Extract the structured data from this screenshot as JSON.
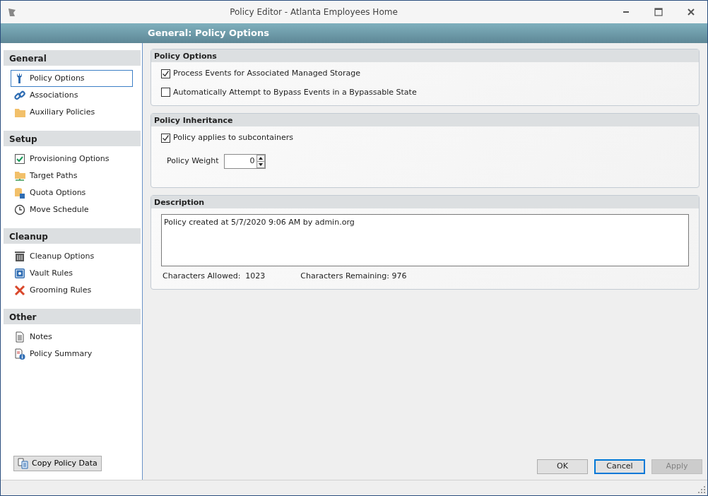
{
  "window": {
    "title": "Policy Editor - Atlanta Employees Home"
  },
  "header": {
    "title": "General: Policy Options"
  },
  "sidebar": {
    "sections": [
      {
        "title": "General",
        "items": [
          {
            "label": "Policy Options",
            "selected": true
          },
          {
            "label": "Associations",
            "selected": false
          },
          {
            "label": "Auxiliary Policies",
            "selected": false
          }
        ]
      },
      {
        "title": "Setup",
        "items": [
          {
            "label": "Provisioning Options",
            "selected": false
          },
          {
            "label": "Target Paths",
            "selected": false
          },
          {
            "label": "Quota Options",
            "selected": false
          },
          {
            "label": "Move Schedule",
            "selected": false
          }
        ]
      },
      {
        "title": "Cleanup",
        "items": [
          {
            "label": "Cleanup Options",
            "selected": false
          },
          {
            "label": "Vault Rules",
            "selected": false
          },
          {
            "label": "Grooming Rules",
            "selected": false
          }
        ]
      },
      {
        "title": "Other",
        "items": [
          {
            "label": "Notes",
            "selected": false
          },
          {
            "label": "Policy Summary",
            "selected": false
          }
        ]
      }
    ],
    "copy_button": "Copy Policy Data"
  },
  "panels": [
    {
      "title": "Policy Options",
      "fields": [
        {
          "kind": "checkbox",
          "label": "Process Events for Associated Managed Storage",
          "checked": true
        },
        {
          "kind": "checkbox",
          "label": "Automatically Attempt to Bypass Events in a Bypassable State",
          "checked": false
        }
      ]
    },
    {
      "title": "Policy Inheritance",
      "fields": [
        {
          "kind": "checkbox",
          "label": "Policy applies to subcontainers",
          "checked": true
        },
        {
          "kind": "spinner",
          "label": "Policy Weight",
          "value": "0"
        }
      ]
    },
    {
      "title": "Description",
      "fields": [
        {
          "kind": "textarea",
          "value": "Policy created at 5/7/2020 9:06 AM by admin.org"
        },
        {
          "kind": "counts",
          "allowed_label": "Characters Allowed:",
          "allowed": "1023",
          "remaining_label": "Characters Remaining:",
          "remaining": "976"
        }
      ]
    }
  ],
  "buttons": [
    {
      "label": "OK",
      "focused": false,
      "disabled": false
    },
    {
      "label": "Cancel",
      "focused": true,
      "disabled": false
    },
    {
      "label": "Apply",
      "focused": false,
      "disabled": true
    }
  ]
}
